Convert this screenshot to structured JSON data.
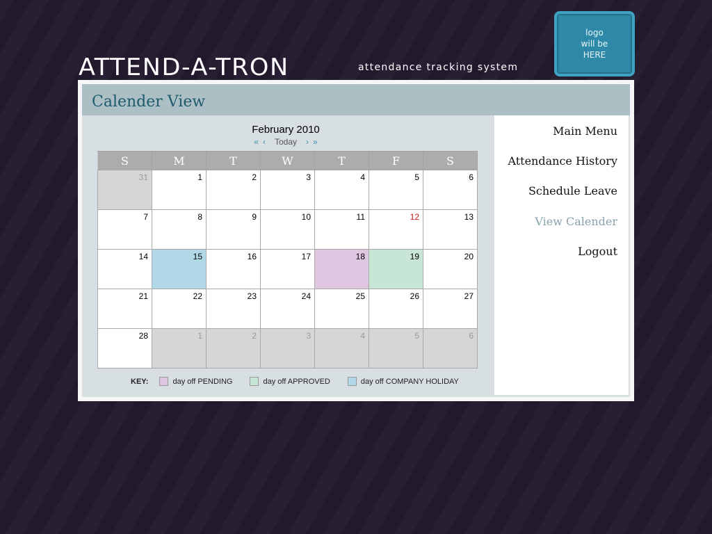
{
  "logo": {
    "text": "logo\nwill be\nHERE"
  },
  "brand": {
    "name": "ATTEND-A-TRON",
    "tagline": "attendance tracking system"
  },
  "page": {
    "title": "Calender View"
  },
  "calendar": {
    "month_label": "February 2010",
    "nav": {
      "first": "«",
      "prev": "‹",
      "today": "Today",
      "next": "›",
      "last": "»"
    },
    "weekdays": [
      "S",
      "M",
      "T",
      "W",
      "T",
      "F",
      "S"
    ],
    "weeks": [
      [
        {
          "d": "31",
          "t": "other"
        },
        {
          "d": "1"
        },
        {
          "d": "2"
        },
        {
          "d": "3"
        },
        {
          "d": "4"
        },
        {
          "d": "5"
        },
        {
          "d": "6"
        }
      ],
      [
        {
          "d": "7"
        },
        {
          "d": "8"
        },
        {
          "d": "9"
        },
        {
          "d": "10"
        },
        {
          "d": "11"
        },
        {
          "d": "12",
          "t": "red"
        },
        {
          "d": "13"
        }
      ],
      [
        {
          "d": "14"
        },
        {
          "d": "15",
          "t": "holiday"
        },
        {
          "d": "16"
        },
        {
          "d": "17"
        },
        {
          "d": "18",
          "t": "pending"
        },
        {
          "d": "19",
          "t": "approved"
        },
        {
          "d": "20"
        }
      ],
      [
        {
          "d": "21"
        },
        {
          "d": "22"
        },
        {
          "d": "23"
        },
        {
          "d": "24"
        },
        {
          "d": "25"
        },
        {
          "d": "26"
        },
        {
          "d": "27"
        }
      ],
      [
        {
          "d": "28"
        },
        {
          "d": "1",
          "t": "other"
        },
        {
          "d": "2",
          "t": "other"
        },
        {
          "d": "3",
          "t": "other"
        },
        {
          "d": "4",
          "t": "other"
        },
        {
          "d": "5",
          "t": "other"
        },
        {
          "d": "6",
          "t": "other"
        }
      ]
    ],
    "colors": {
      "pending": "#dec6e1",
      "approved": "#c8e6d6",
      "holiday": "#b0d8e6",
      "other_month": "#d6d6d6",
      "highlight_text": "#cc1111"
    }
  },
  "key": {
    "label": "KEY:",
    "items": [
      {
        "label": "day off PENDING",
        "color": "#dec6e1"
      },
      {
        "label": "day off APPROVED",
        "color": "#c8e6d6"
      },
      {
        "label": "day off COMPANY HOLIDAY",
        "color": "#b0d8e6"
      }
    ]
  },
  "nav": {
    "items": [
      {
        "label": "Main Menu",
        "active": false
      },
      {
        "label": "Attendance History",
        "active": false
      },
      {
        "label": "Schedule Leave",
        "active": false
      },
      {
        "label": "View Calender",
        "active": true
      },
      {
        "label": "Logout",
        "active": false
      }
    ]
  }
}
